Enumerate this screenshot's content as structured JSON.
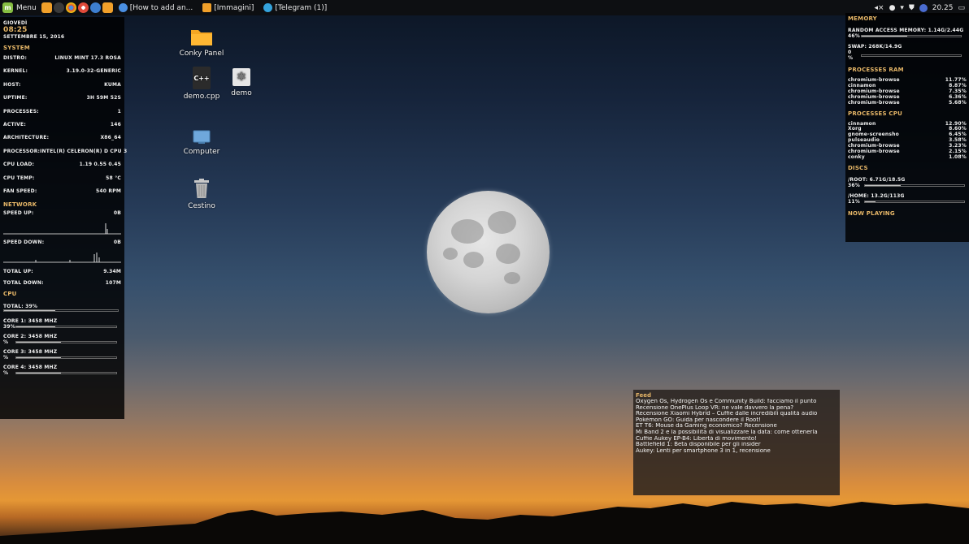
{
  "taskbar": {
    "menu_label": "Menu",
    "launchers": [
      {
        "icon": "files-icon",
        "color": "#f1a02a"
      },
      {
        "icon": "terminal-icon",
        "color": "#3a3a3a"
      },
      {
        "icon": "chrome-icon",
        "color": "#dd4b39"
      },
      {
        "icon": "chromium-icon",
        "color": "#4a8fe2"
      },
      {
        "icon": "browser-icon",
        "color": "#3d7fd0"
      },
      {
        "icon": "folder-icon",
        "color": "#f1a02a"
      }
    ],
    "windows": [
      {
        "label": "[How to add an...",
        "icon": "chromium-icon",
        "color": "#4a8fe2"
      },
      {
        "label": "[Immagini]",
        "icon": "folder-icon",
        "color": "#f1a02a"
      },
      {
        "label": "[Telegram (1)]",
        "icon": "telegram-icon",
        "color": "#34a3dc"
      }
    ],
    "clock": "20.25"
  },
  "left_panel": {
    "day": "Giovedì",
    "time": "08:25",
    "date": "Settembre 15, 2016",
    "system_title": "System",
    "system": [
      {
        "label": "Distro:",
        "value": "Linux Mint 17.3 Rosa"
      },
      {
        "label": "Kernel:",
        "value": "3.19.0-32-generic"
      },
      {
        "label": "Host:",
        "value": "kuma"
      },
      {
        "label": "Uptime:",
        "value": "3h 59m 52s"
      },
      {
        "label": "Processes:",
        "value": "1"
      },
      {
        "label": "Active:",
        "value": "146"
      },
      {
        "label": "Architecture:",
        "value": "x86_64"
      },
      {
        "label": "Processor:",
        "value": "Intel(R) Celeron(R) D CPU 3"
      },
      {
        "label": "CPU Load:",
        "value": "1.19 0.55 0.45"
      },
      {
        "label": "CPU Temp:",
        "value": "58 °C"
      },
      {
        "label": "Fan Speed:",
        "value": "540 RPM"
      }
    ],
    "network_title": "Network",
    "speed_up_label": "Speed Up:",
    "speed_up_value": "0B",
    "speed_down_label": "Speed Down:",
    "speed_down_value": "0B",
    "total_up_label": "Total Up:",
    "total_up_value": "9.34M",
    "total_down_label": "Total Down:",
    "total_down_value": "107M",
    "cpu_title": "CPU",
    "cpu_total_label": "Total: 39%",
    "cpu_total_level": 0.45,
    "cores": [
      {
        "label": "Core 1: 3458 MHz",
        "pct": "39%",
        "level": 0.39
      },
      {
        "label": "Core 2: 3458 MHz",
        "pct": "%",
        "level": 0.45
      },
      {
        "label": "Core 3: 3458 MHz",
        "pct": "%",
        "level": 0.45
      },
      {
        "label": "Core 4: 3458 MHz",
        "pct": "%",
        "level": 0.45
      }
    ]
  },
  "right_panel": {
    "memory_title": "Memory",
    "ram_label": "Random Access Memory: 1.14G/2.44G",
    "ram_pct": "46%",
    "ram_level": 0.46,
    "swap_label": "Swap: 268K/14.9G",
    "swap_pct": "0 %",
    "swap_level": 0.0,
    "proc_ram_title": "Processes RAM",
    "proc_ram": [
      {
        "name": "chromium-browse",
        "value": "11.77%"
      },
      {
        "name": "cinnamon",
        "value": "8.87%"
      },
      {
        "name": "chromium-browse",
        "value": "7.35%"
      },
      {
        "name": "chromium-browse",
        "value": "6.36%"
      },
      {
        "name": "chromium-browse",
        "value": "5.68%"
      }
    ],
    "proc_cpu_title": "Processes CPU",
    "proc_cpu": [
      {
        "name": "cinnamon",
        "value": "12.90%"
      },
      {
        "name": "Xorg",
        "value": "8.60%"
      },
      {
        "name": "gnome-screensho",
        "value": "6.45%"
      },
      {
        "name": "pulseaudio",
        "value": "3.58%"
      },
      {
        "name": "chromium-browse",
        "value": "3.23%"
      },
      {
        "name": "chromium-browse",
        "value": "2.15%"
      },
      {
        "name": "conky",
        "value": "1.08%"
      }
    ],
    "discs_title": "Discs",
    "root_label": "/root: 6.71G/18.5G",
    "root_pct": "36%",
    "root_level": 0.36,
    "home_label": "/home: 13.2G/113G",
    "home_pct": "11%",
    "home_level": 0.11,
    "now_playing_title": "Now Playing"
  },
  "desktop": {
    "icons": [
      {
        "label": "Conky Panel",
        "icon": "folder-icon"
      },
      {
        "label": "demo.cpp",
        "icon": "cpp-file-icon"
      },
      {
        "label": "demo",
        "icon": "executable-icon"
      },
      {
        "label": "Computer",
        "icon": "computer-icon"
      },
      {
        "label": "Cestino",
        "icon": "trash-icon"
      }
    ]
  },
  "feed": {
    "title": "Feed",
    "items": [
      "Oxygen Os, Hydrogen Os e Community Build: facciamo il punto",
      "Recensione OnePlus Loop VR: ne vale davvero la pena?",
      "Recensione Xiaomi Hybrid – Cuffie dalle incredibili qualità audio",
      "Pokémon GO: Guida per nascondere il Root!",
      "ET T6: Mouse da Gaming economico? Recensione",
      "Mi Band 2 e la possibilità di visualizzare la data: come ottenerla",
      "Cuffie Aukey EP-B4: Libertà di movimento!",
      "Battlefield 1: Beta disponibile per gli insider",
      "Aukey: Lenti per smartphone 3 in 1, recensione"
    ]
  }
}
